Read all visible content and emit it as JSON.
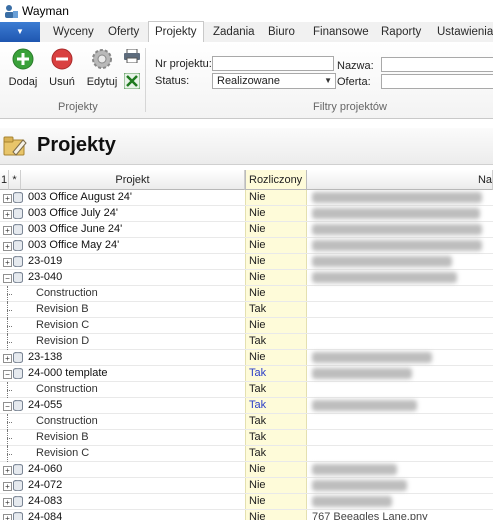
{
  "window": {
    "title": "Wayman"
  },
  "ribbon_tabs": [
    "Wyceny",
    "Oferty",
    "Projekty",
    "Zadania",
    "Biuro",
    "Finansowe",
    "Raporty",
    "Ustawienia"
  ],
  "active_tab": "Projekty",
  "actions": {
    "add": "Dodaj",
    "remove": "Usuń",
    "edit": "Edytuj",
    "group_label": "Projekty"
  },
  "filters": {
    "project_no_label": "Nr projektu:",
    "project_no_value": "",
    "status_label": "Status:",
    "status_value": "Realizowane",
    "name_label": "Nazwa:",
    "name_value": "",
    "offer_label": "Oferta:",
    "offer_value": "",
    "group_label": "Filtry projektów"
  },
  "section": {
    "title": "Projekty"
  },
  "grid": {
    "columns": {
      "num": "1",
      "star": "*",
      "project": "Projekt",
      "settled": "Rozliczony",
      "name_partial": "Na"
    },
    "rows": [
      {
        "name": "003 Office August 24'",
        "settled": "Nie",
        "level": 0
      },
      {
        "name": "003 Office July 24'",
        "settled": "Nie",
        "level": 0
      },
      {
        "name": "003 Office June 24'",
        "settled": "Nie",
        "level": 0
      },
      {
        "name": "003 Office May 24'",
        "settled": "Nie",
        "level": 0
      },
      {
        "name": "23-019",
        "settled": "Nie",
        "level": 0
      },
      {
        "name": "23-040",
        "settled": "Nie",
        "level": 0,
        "expanded": true
      },
      {
        "name": "Construction",
        "settled": "Nie",
        "level": 1
      },
      {
        "name": "Revision B",
        "settled": "Tak",
        "level": 1
      },
      {
        "name": "Revision C",
        "settled": "Nie",
        "level": 1
      },
      {
        "name": "Revision D",
        "settled": "Tak",
        "level": 1
      },
      {
        "name": "23-138",
        "settled": "Nie",
        "level": 0
      },
      {
        "name": "24-000 template",
        "settled": "Tak",
        "level": 0,
        "expanded": true,
        "highlight": true
      },
      {
        "name": "Construction",
        "settled": "Tak",
        "level": 1
      },
      {
        "name": "24-055",
        "settled": "Tak",
        "level": 0,
        "expanded": true,
        "highlight": true
      },
      {
        "name": "Construction",
        "settled": "Tak",
        "level": 1
      },
      {
        "name": "Revision B",
        "settled": "Tak",
        "level": 1
      },
      {
        "name": "Revision C",
        "settled": "Tak",
        "level": 1
      },
      {
        "name": "24-060",
        "settled": "Nie",
        "level": 0
      },
      {
        "name": "24-072",
        "settled": "Nie",
        "level": 0
      },
      {
        "name": "24-083",
        "settled": "Nie",
        "level": 0
      },
      {
        "name": "24-084",
        "settled": "Nie",
        "level": 0
      }
    ],
    "last_row_name_partial": "767 Beeagles Lane.pny"
  },
  "colors": {
    "settled_bg": "#fefbd9",
    "tak_blue": "#2b3ec7",
    "menu_blue": "#2a64c2"
  },
  "icons": [
    "app-icon",
    "add-icon",
    "remove-icon",
    "edit-gear-icon",
    "print-icon",
    "excel-icon",
    "folder-edit-icon",
    "database-icon"
  ]
}
